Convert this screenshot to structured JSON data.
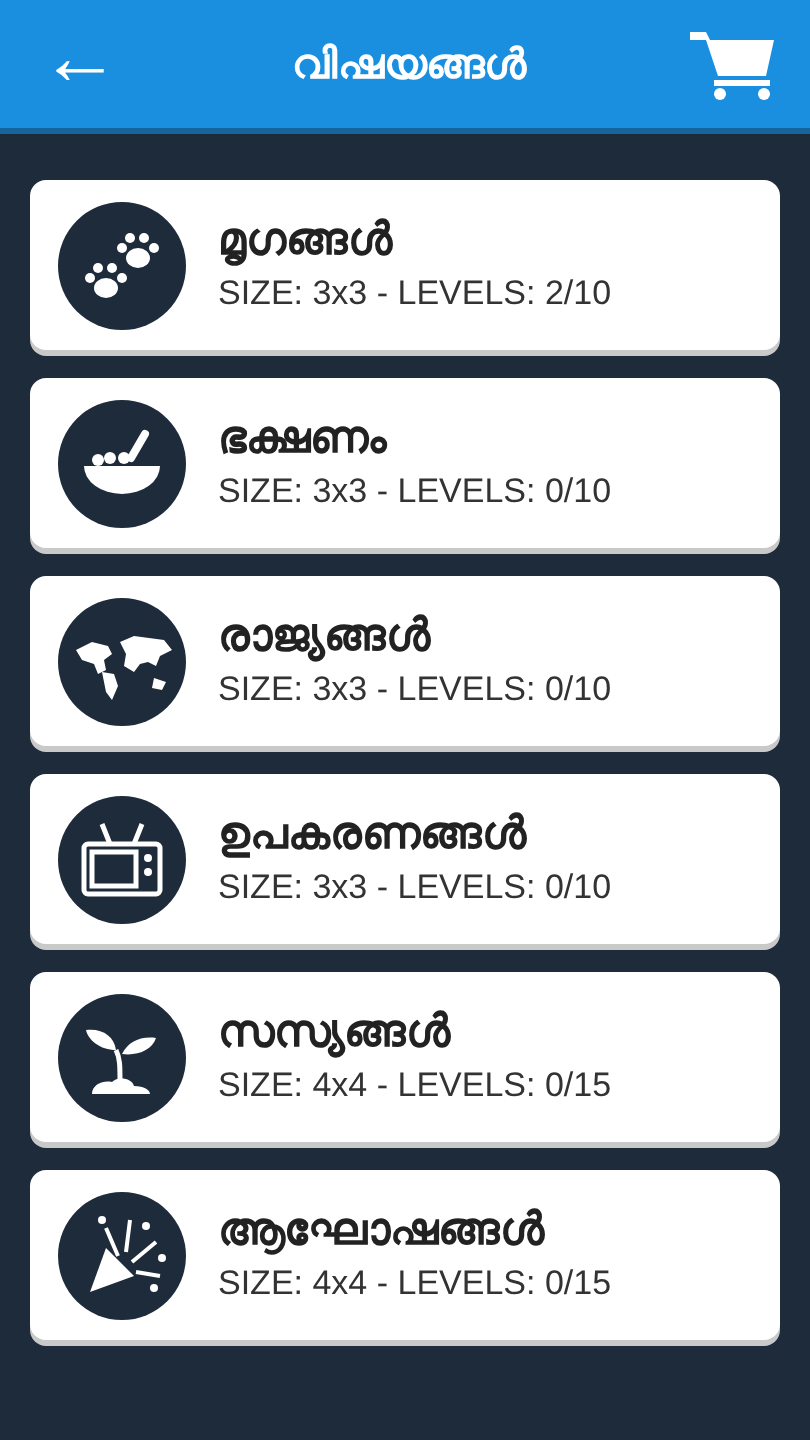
{
  "header": {
    "back": "←",
    "title": "വിഷയങ്ങൾ"
  },
  "categories": [
    {
      "kind": "paws",
      "name": "മൃഗങ്ങൾ",
      "info": "SIZE: 3x3 - LEVELS: 2/10"
    },
    {
      "kind": "bowl",
      "name": "ഭക്ഷണം",
      "info": "SIZE: 3x3 - LEVELS: 0/10"
    },
    {
      "kind": "globe",
      "name": "രാജ്യങ്ങൾ",
      "info": "SIZE: 3x3 - LEVELS: 0/10"
    },
    {
      "kind": "tv",
      "name": "ഉപകരണങ്ങൾ",
      "info": "SIZE: 3x3 - LEVELS: 0/10"
    },
    {
      "kind": "sprout",
      "name": "സസ്യങ്ങൾ",
      "info": "SIZE: 4x4 - LEVELS: 0/15"
    },
    {
      "kind": "party",
      "name": "ആഘോഷങ്ങൾ",
      "info": "SIZE: 4x4 - LEVELS: 0/15"
    }
  ]
}
